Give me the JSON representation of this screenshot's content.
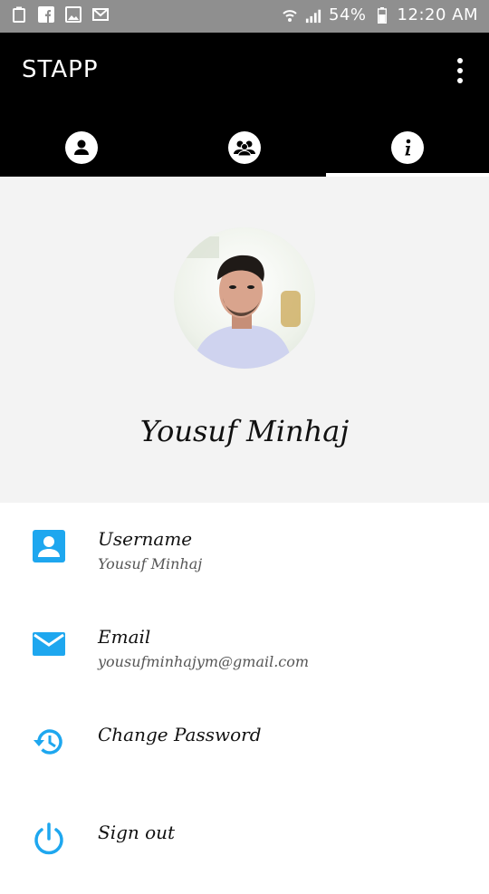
{
  "status_bar": {
    "battery_percent": "54%",
    "time": "12:20 AM",
    "icons": [
      "recycle-icon",
      "facebook-icon",
      "image-icon",
      "mail-icon",
      "wifi-icon",
      "signal-icon",
      "battery-icon"
    ]
  },
  "app_bar": {
    "title": "STAPP",
    "overflow_icon": "more-vert-icon"
  },
  "tabs": [
    {
      "icon": "person-icon",
      "active": false
    },
    {
      "icon": "group-icon",
      "active": false
    },
    {
      "icon": "info-icon",
      "active": true
    }
  ],
  "profile": {
    "name": "Yousuf Minhaj",
    "avatar": "profile-photo"
  },
  "items": [
    {
      "title": "Username",
      "subtitle": "Yousuf Minhaj",
      "icon": "account-box-icon"
    },
    {
      "title": "Email",
      "subtitle": "yousufminhajym@gmail.com",
      "icon": "email-icon"
    },
    {
      "title": "Change Password",
      "subtitle": "",
      "icon": "history-icon"
    },
    {
      "title": "Sign out",
      "subtitle": "",
      "icon": "power-icon"
    }
  ],
  "colors": {
    "accent": "#1ea7ef",
    "app_bar": "#000000",
    "status_bar": "#8f8f8f",
    "header_bg": "#f3f3f3"
  }
}
